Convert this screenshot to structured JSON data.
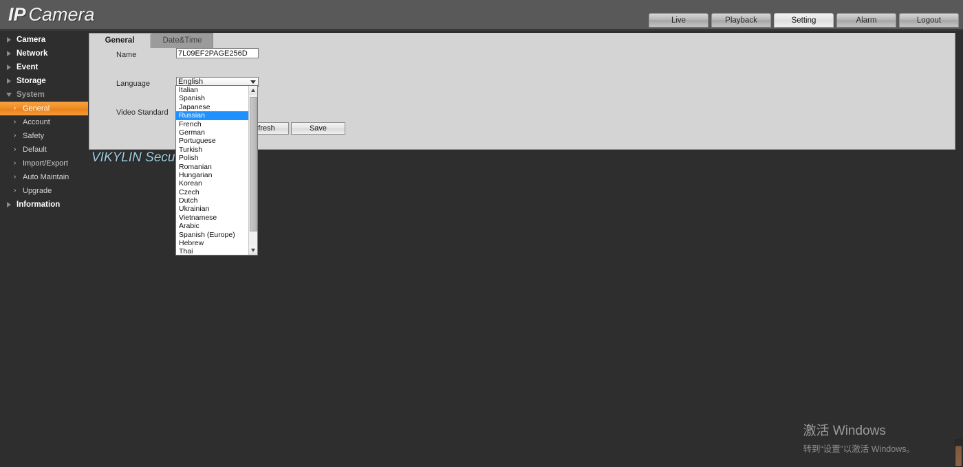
{
  "header": {
    "logo_bold": "IP",
    "logo_light": "Camera",
    "nav": [
      {
        "label": "Live",
        "active": false
      },
      {
        "label": "Playback",
        "active": false
      },
      {
        "label": "Setting",
        "active": true
      },
      {
        "label": "Alarm",
        "active": false
      },
      {
        "label": "Logout",
        "active": false
      }
    ]
  },
  "sidebar": {
    "groups": [
      {
        "label": "Camera",
        "expanded": false
      },
      {
        "label": "Network",
        "expanded": false
      },
      {
        "label": "Event",
        "expanded": false
      },
      {
        "label": "Storage",
        "expanded": false
      },
      {
        "label": "System",
        "expanded": true
      },
      {
        "label": "Information",
        "expanded": false
      }
    ],
    "system_items": [
      {
        "label": "General",
        "selected": true
      },
      {
        "label": "Account",
        "selected": false
      },
      {
        "label": "Safety",
        "selected": false
      },
      {
        "label": "Default",
        "selected": false
      },
      {
        "label": "Import/Export",
        "selected": false
      },
      {
        "label": "Auto Maintain",
        "selected": false
      },
      {
        "label": "Upgrade",
        "selected": false
      }
    ],
    "chevron": "›"
  },
  "content": {
    "tabs": [
      {
        "label": "General",
        "active": true
      },
      {
        "label": "Date&Time",
        "active": false
      }
    ],
    "fields": {
      "name_label": "Name",
      "name_value": "7L09EF2PAGE256D",
      "language_label": "Language",
      "language_value": "English",
      "video_standard_label": "Video Standard"
    },
    "buttons": {
      "refresh": "Refresh",
      "save": "Save"
    }
  },
  "language_dropdown": {
    "selected": "Russian",
    "options": [
      "Italian",
      "Spanish",
      "Japanese",
      "Russian",
      "French",
      "German",
      "Portuguese",
      "Turkish",
      "Polish",
      "Romanian",
      "Hungarian",
      "Korean",
      "Czech",
      "Dutch",
      "Ukrainian",
      "Vietnamese",
      "Arabic",
      "Spanish (Europe)",
      "Hebrew",
      "Thai"
    ]
  },
  "watermarks": {
    "vendor": "VIKYLIN Security Store",
    "windows_title": "激活 Windows",
    "windows_sub": "转到“设置”以激活 Windows。"
  },
  "colors": {
    "accent_orange": "#ef8d21",
    "selection_blue": "#1e90ff",
    "header_grey": "#595959",
    "panel_grey": "#d4d4d4"
  }
}
